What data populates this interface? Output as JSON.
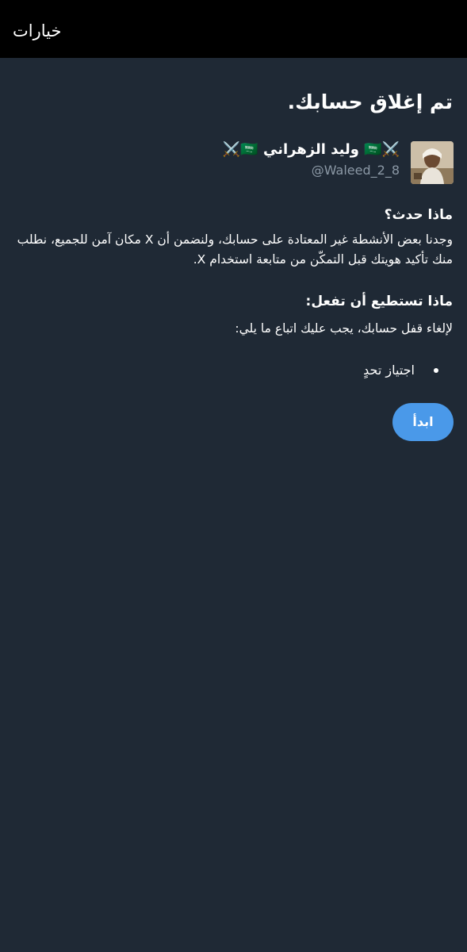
{
  "topbar": {
    "title": "خيارات"
  },
  "main": {
    "title": "تم إغلاق حسابك.",
    "account": {
      "name": "⚔️🇸🇦 وليد الزهراني 🇸🇦⚔️",
      "handle": "@Waleed_2_8",
      "avatar_icon": "profile-photo"
    },
    "what_happened": {
      "heading": "ماذا حدث؟",
      "body": "وجدنا بعض الأنشطة غير المعتادة على حسابك، ولنضمن أن X مكان آمن للجميع، نطلب منك تأكيد هويتك قبل التمكّن من متابعة استخدام X."
    },
    "what_you_can_do": {
      "heading": "ماذا تستطيع أن تفعل:",
      "body": "لإلغاء قفل حسابك، يجب عليك اتباع ما يلي:",
      "steps": [
        "اجتياز تحدٍ"
      ]
    },
    "start_button_label": "ابدأ"
  },
  "colors": {
    "background": "#1f2935",
    "topbar": "#000000",
    "accent": "#4a99e9",
    "muted_text": "#8b98a5"
  }
}
